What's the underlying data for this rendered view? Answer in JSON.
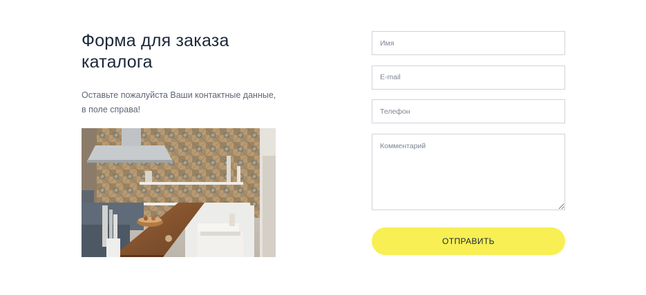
{
  "heading": "Форма для заказа каталога",
  "subtitle": "Оставьте пожалуйста Ваши контактные данные, в поле справа!",
  "image": {
    "alt": "kitchen-photo",
    "colors": {
      "tile": "#b99a72",
      "wood": "#8a5a34",
      "hood": "#bfc3c6",
      "wall_light": "#e6e2dc"
    }
  },
  "form": {
    "name_placeholder": "Имя",
    "email_placeholder": "E-mail",
    "phone_placeholder": "Телефон",
    "comment_placeholder": "Комментарий",
    "submit_label": "ОТПРАВИТЬ"
  },
  "colors": {
    "accent": "#f7ef53",
    "heading": "#1c2738",
    "text": "#5c6676",
    "border": "#cfd3db"
  }
}
